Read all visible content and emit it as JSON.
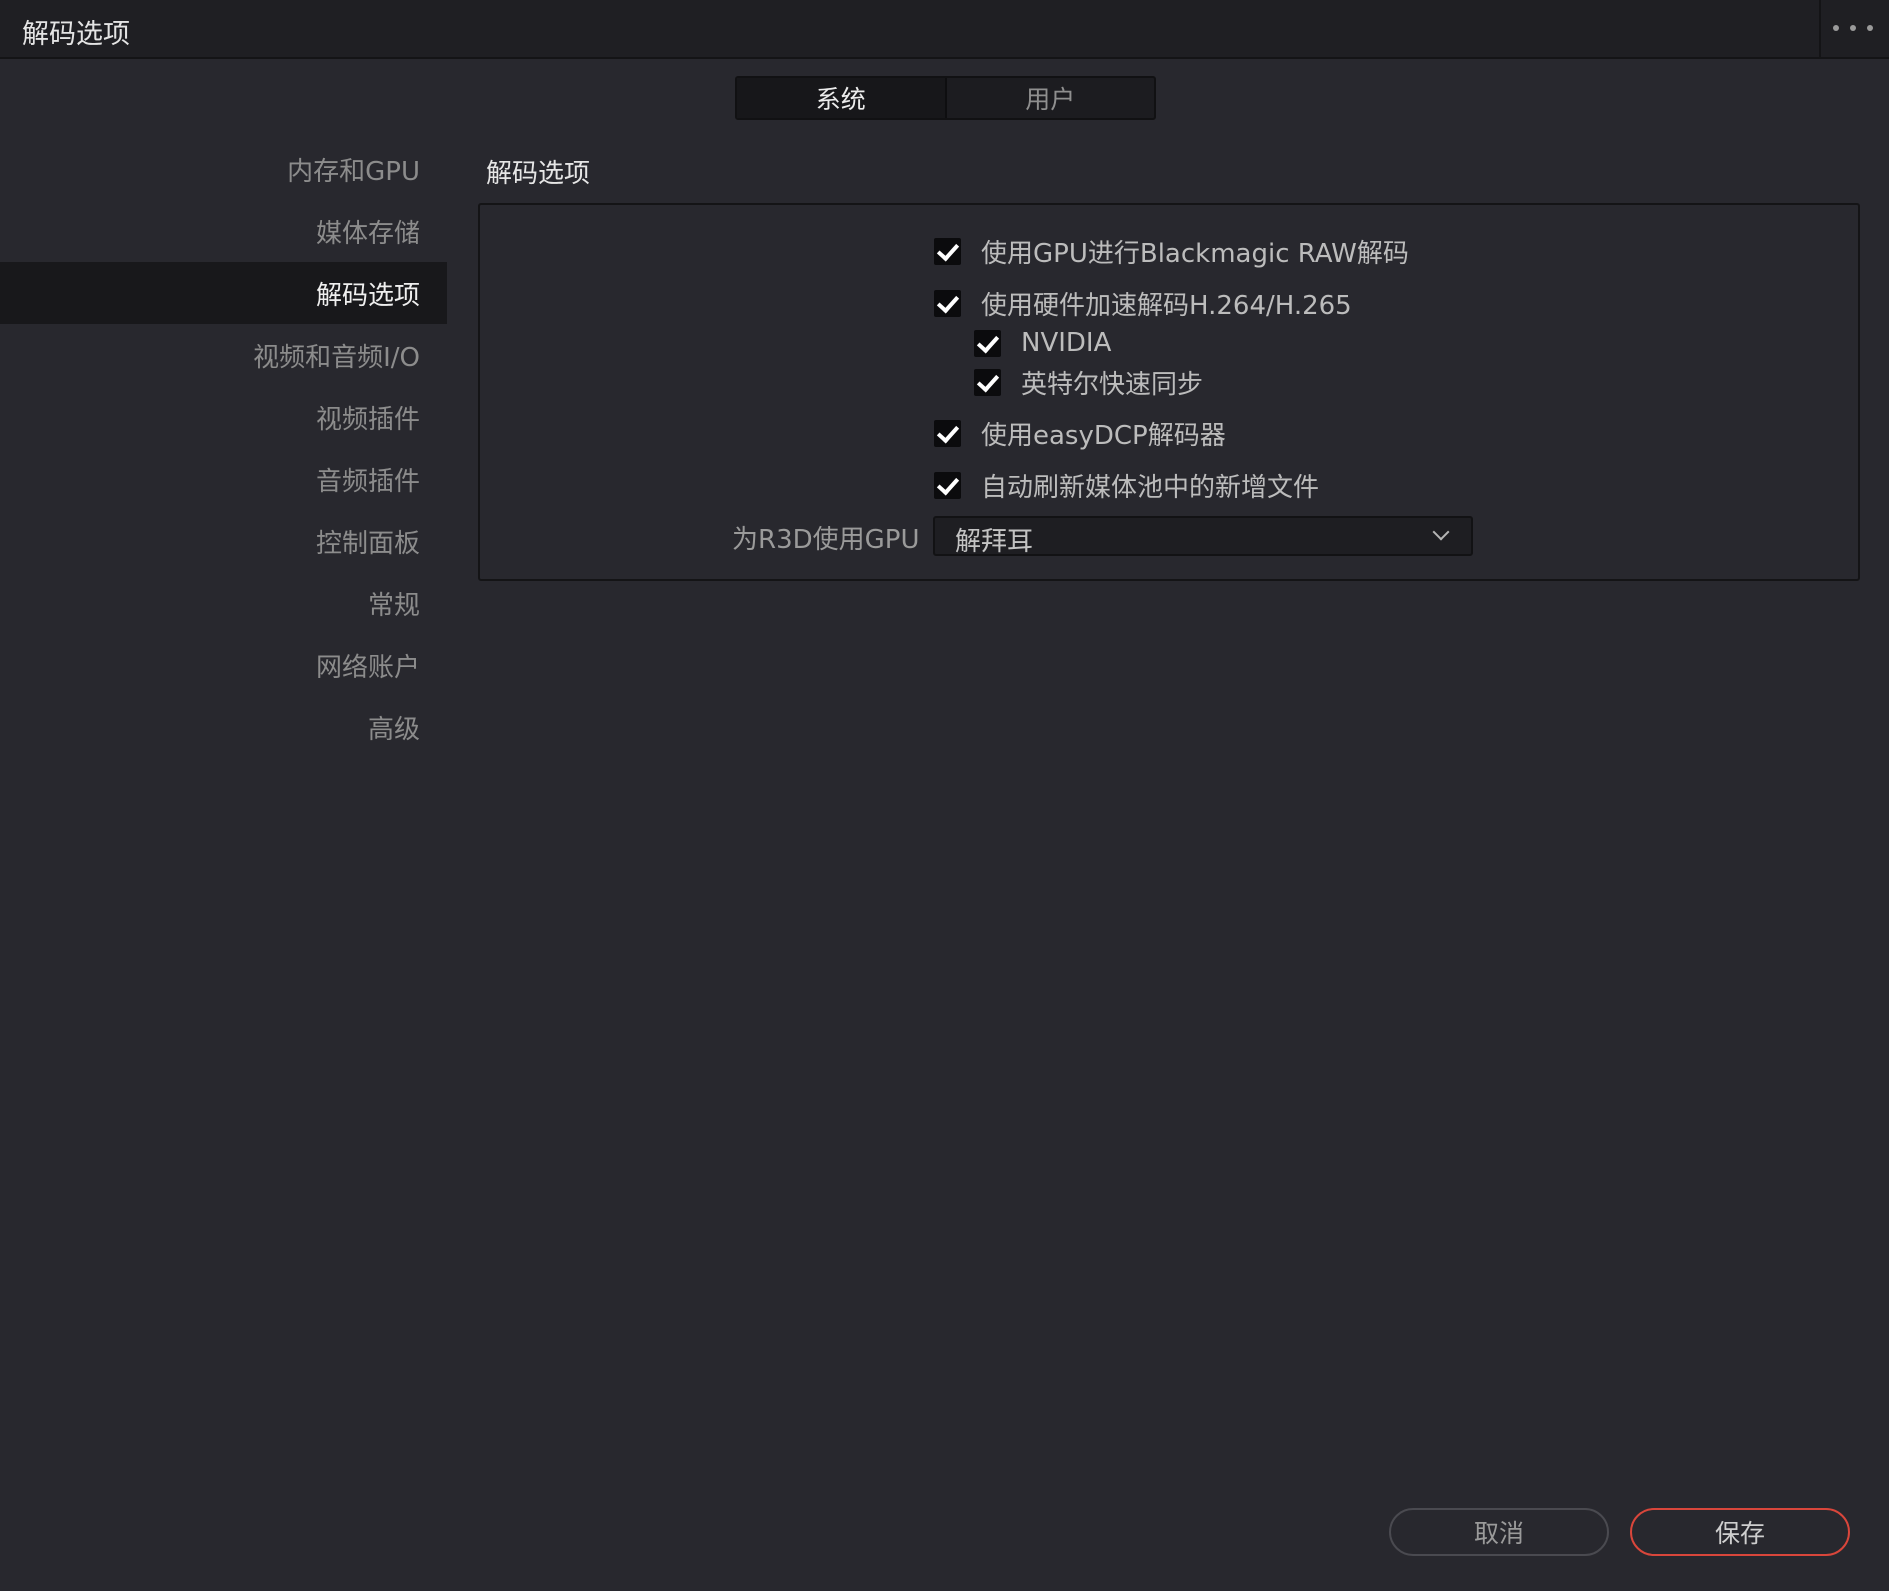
{
  "window": {
    "title": "解码选项"
  },
  "tabs": [
    {
      "label": "系统",
      "active": true
    },
    {
      "label": "用户",
      "active": false
    }
  ],
  "sidebar": {
    "items": [
      {
        "label": "内存和GPU"
      },
      {
        "label": "媒体存储"
      },
      {
        "label": "解码选项",
        "active": true
      },
      {
        "label": "视频和音频I/O"
      },
      {
        "label": "视频插件"
      },
      {
        "label": "音频插件"
      },
      {
        "label": "控制面板"
      },
      {
        "label": "常规"
      },
      {
        "label": "网络账户"
      },
      {
        "label": "高级"
      }
    ]
  },
  "section": {
    "title": "解码选项",
    "options": [
      {
        "label": "使用GPU进行Blackmagic RAW解码",
        "checked": true
      },
      {
        "label": "使用硬件加速解码H.264/H.265",
        "checked": true
      },
      {
        "label": "NVIDIA",
        "checked": true
      },
      {
        "label": "英特尔快速同步",
        "checked": true
      },
      {
        "label": "使用easyDCP解码器",
        "checked": true
      },
      {
        "label": "自动刷新媒体池中的新增文件",
        "checked": true
      }
    ],
    "r3d_gpu": {
      "label": "为R3D使用GPU",
      "value": "解拜耳"
    }
  },
  "footer": {
    "cancel_label": "取消",
    "save_label": "保存"
  },
  "colors": {
    "background": "#28282e",
    "save_border": "#d9463b"
  }
}
